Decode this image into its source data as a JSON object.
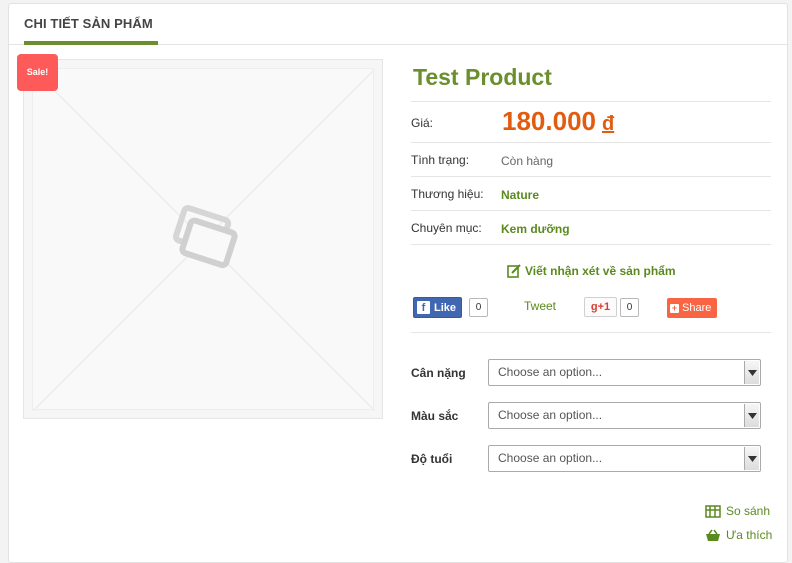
{
  "tab": {
    "title": "CHI TIẾT SẢN PHẨM"
  },
  "badge": {
    "sale": "Sale!"
  },
  "product": {
    "title": "Test Product",
    "price_label": "Giá:",
    "price_value": "180.000",
    "currency": "đ",
    "status_label": "Tình trạng:",
    "status_value": "Còn hàng",
    "brand_label": "Thương hiệu:",
    "brand_value": "Nature",
    "category_label": "Chuyên mục:",
    "category_value": "Kem dưỡng"
  },
  "review": {
    "label": "Viết nhận xét về sản phẩm"
  },
  "social": {
    "fb_like": "Like",
    "fb_count": "0",
    "tweet": "Tweet",
    "gplus": "+1",
    "gplus_count": "0",
    "share": "Share"
  },
  "options": [
    {
      "label": "Cân nặng",
      "placeholder": "Choose an option..."
    },
    {
      "label": "Màu sắc",
      "placeholder": "Choose an option..."
    },
    {
      "label": "Độ tuổi",
      "placeholder": "Choose an option..."
    }
  ],
  "actions": {
    "compare": "So sánh",
    "wishlist": "Ưa thích"
  },
  "colors": {
    "accent_green": "#6a8f2c",
    "price_orange": "#e25c0f",
    "sale_red": "#ff5a5a"
  }
}
